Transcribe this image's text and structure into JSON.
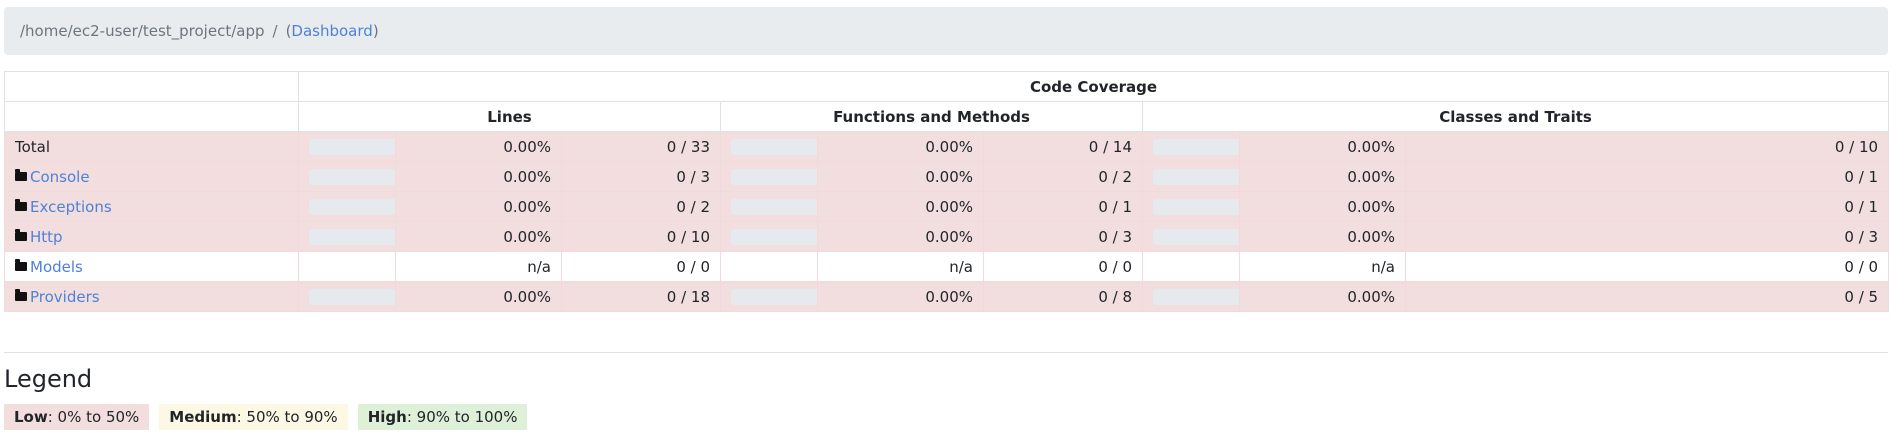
{
  "breadcrumb": {
    "path": "/home/ec2-user/test_project/app",
    "separator": "/",
    "open_paren": "(",
    "link": "Dashboard",
    "close_paren": ")"
  },
  "table": {
    "header_top": "Code Coverage",
    "groups": [
      "Lines",
      "Functions and Methods",
      "Classes and Traits"
    ],
    "rows": [
      {
        "name": "Total",
        "is_folder": false,
        "status": "low",
        "lines_pct": "0.00%",
        "lines": "0 / 33",
        "functions_pct": "0.00%",
        "functions": "0 / 14",
        "classes_pct": "0.00%",
        "classes": "0 / 10"
      },
      {
        "name": "Console",
        "is_folder": true,
        "status": "low",
        "lines_pct": "0.00%",
        "lines": "0 / 3",
        "functions_pct": "0.00%",
        "functions": "0 / 2",
        "classes_pct": "0.00%",
        "classes": "0 / 1"
      },
      {
        "name": "Exceptions",
        "is_folder": true,
        "status": "low",
        "lines_pct": "0.00%",
        "lines": "0 / 2",
        "functions_pct": "0.00%",
        "functions": "0 / 1",
        "classes_pct": "0.00%",
        "classes": "0 / 1"
      },
      {
        "name": "Http",
        "is_folder": true,
        "status": "low",
        "lines_pct": "0.00%",
        "lines": "0 / 10",
        "functions_pct": "0.00%",
        "functions": "0 / 3",
        "classes_pct": "0.00%",
        "classes": "0 / 3"
      },
      {
        "name": "Models",
        "is_folder": true,
        "status": "na",
        "lines_pct": "n/a",
        "lines": "0 / 0",
        "functions_pct": "n/a",
        "functions": "0 / 0",
        "classes_pct": "n/a",
        "classes": "0 / 0"
      },
      {
        "name": "Providers",
        "is_folder": true,
        "status": "low",
        "lines_pct": "0.00%",
        "lines": "0 / 18",
        "functions_pct": "0.00%",
        "functions": "0 / 8",
        "classes_pct": "0.00%",
        "classes": "0 / 5"
      }
    ]
  },
  "legend": {
    "title": "Legend",
    "items": [
      {
        "label": "Low",
        "range": ": 0% to 50%",
        "color": "#f2dede"
      },
      {
        "label": "Medium",
        "range": ": 50% to 90%",
        "color": "#fcf8e3"
      },
      {
        "label": "High",
        "range": ": 90% to 100%",
        "color": "#dff0d8"
      }
    ]
  },
  "colors": {
    "link": "#4d82d6",
    "low_row": "#f2dede",
    "bar_track": "#e6e9ed",
    "breadcrumb_bg": "#e9ecef"
  }
}
